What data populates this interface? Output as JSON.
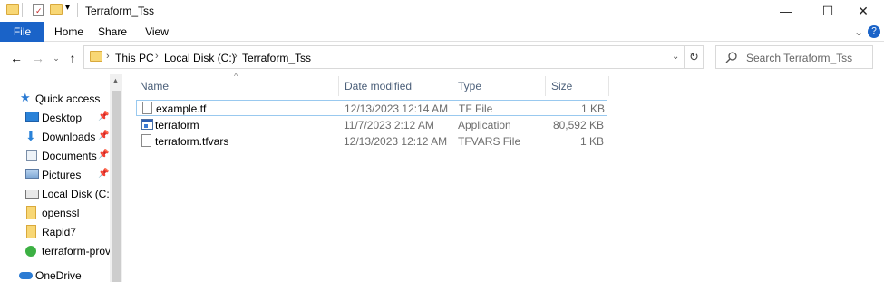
{
  "window": {
    "title": "Terraform_Tss",
    "minimize_glyph": "—",
    "maximize_glyph": "☐",
    "close_glyph": "✕"
  },
  "ribbon": {
    "tabs": [
      "File",
      "Home",
      "Share",
      "View"
    ],
    "file_tab_color": "#1a63c8"
  },
  "address": {
    "crumbs": [
      "This PC",
      "Local Disk (C:)",
      "Terraform_Tss"
    ],
    "separator": "›"
  },
  "search": {
    "placeholder": "Search Terraform_Tss"
  },
  "nav": {
    "items": [
      {
        "label": "Quick access",
        "icon": "star-icon",
        "pinned": false
      },
      {
        "label": "Desktop",
        "icon": "desktop-icon",
        "pinned": true
      },
      {
        "label": "Downloads",
        "icon": "download-icon",
        "pinned": true
      },
      {
        "label": "Documents",
        "icon": "documents-icon",
        "pinned": true
      },
      {
        "label": "Pictures",
        "icon": "pictures-icon",
        "pinned": true
      },
      {
        "label": "Local Disk (C:)",
        "icon": "drive-icon",
        "pinned": false
      },
      {
        "label": "openssl",
        "icon": "folder-icon",
        "pinned": false
      },
      {
        "label": "Rapid7",
        "icon": "folder-icon",
        "pinned": false
      },
      {
        "label": "terraform-provic",
        "icon": "folder-icon",
        "pinned": false
      },
      {
        "label": "OneDrive",
        "icon": "cloud-icon",
        "pinned": false
      }
    ],
    "pin_glyph": "📌"
  },
  "columns": {
    "name": "Name",
    "date": "Date modified",
    "type": "Type",
    "size": "Size"
  },
  "files": [
    {
      "name": "example.tf",
      "date": "12/13/2023 12:14 AM",
      "type": "TF File",
      "size": "1 KB",
      "icon": "file-icon",
      "selected": true
    },
    {
      "name": "terraform",
      "date": "11/7/2023 2:12 AM",
      "type": "Application",
      "size": "80,592 KB",
      "icon": "application-icon",
      "selected": false
    },
    {
      "name": "terraform.tfvars",
      "date": "12/13/2023 12:12 AM",
      "type": "TFVARS File",
      "size": "1 KB",
      "icon": "file-icon",
      "selected": false
    }
  ]
}
